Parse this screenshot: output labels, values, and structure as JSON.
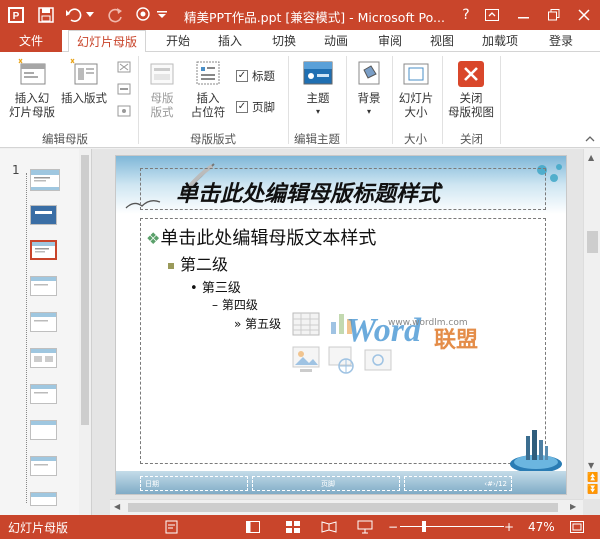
{
  "app": {
    "title": "精美PPT作品.ppt [兼容模式] - Microsoft Po...",
    "help_label": "?",
    "accent_color": "#c9452b"
  },
  "quick_access": {
    "icons": [
      "powerpoint-icon",
      "save-icon",
      "undo-icon",
      "redo-icon",
      "touch-mode-icon"
    ]
  },
  "tabs": {
    "file": "文件",
    "items": [
      "幻灯片母版",
      "开始",
      "插入",
      "切换",
      "动画",
      "审阅",
      "视图",
      "加载项",
      "登录"
    ]
  },
  "ribbon": {
    "edit_master": {
      "label": "编辑母版",
      "insert_master": "插入幻\n灯片母版",
      "insert_layout": "插入版式"
    },
    "master_layout": {
      "label": "母版版式",
      "master_layout_btn": "母版\n版式",
      "insert_placeholder": "插入\n占位符",
      "title_chk": "标题",
      "footer_chk": "页脚"
    },
    "edit_theme": {
      "label": "编辑主题",
      "theme": "主题"
    },
    "background": {
      "label": "背景"
    },
    "size": {
      "label": "大小",
      "slide_size": "幻灯片\n大小"
    },
    "close": {
      "label": "关闭",
      "close_master": "关闭\n母版视图"
    }
  },
  "thumbnails": {
    "slide_number": "1"
  },
  "slide": {
    "title": "单击此处编辑母版标题样式",
    "level1": "单击此处编辑母版文本样式",
    "level2": "第二级",
    "level3": "第三级",
    "level4": "第四级",
    "level5": "第五级",
    "footer_date": "日期",
    "footer_text": "页脚",
    "footer_num": "‹#›/12",
    "watermark_word": "Word",
    "watermark_cn": "联盟",
    "watermark_url": "www.wordlm.com"
  },
  "status": {
    "view_name": "幻灯片母版",
    "zoom_level": "47%",
    "zoom_minus": "−",
    "zoom_plus": "+",
    "zoom_fraction": 0.23
  }
}
